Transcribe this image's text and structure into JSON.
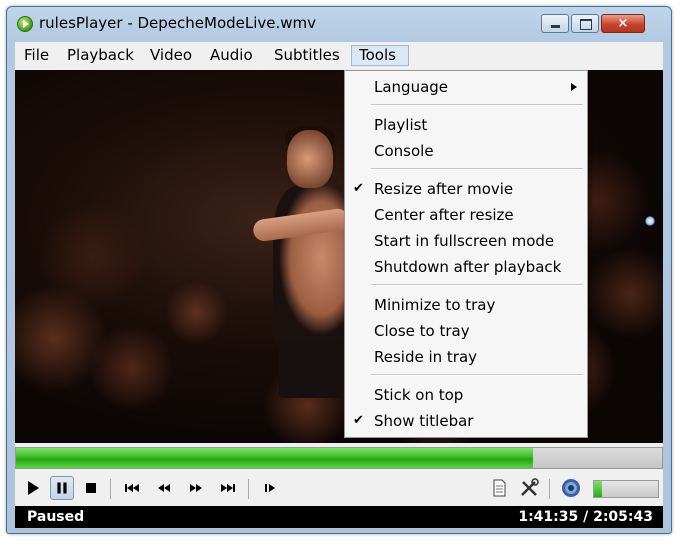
{
  "window": {
    "title": "rulesPlayer - DepecheModeLive.wmv",
    "close_glyph": "×"
  },
  "menubar": {
    "items": [
      {
        "label": "File"
      },
      {
        "label": "Playback"
      },
      {
        "label": "Video"
      },
      {
        "label": "Audio"
      },
      {
        "label": "Subtitles"
      },
      {
        "label": "Tools",
        "active": true
      }
    ]
  },
  "tools_menu": {
    "items": [
      {
        "label": "Language",
        "checked": false,
        "submenu": true
      },
      {
        "label": "Playlist",
        "checked": false
      },
      {
        "label": "Console",
        "checked": false
      },
      {
        "label": "Resize after movie",
        "checked": true
      },
      {
        "label": "Center after resize",
        "checked": false
      },
      {
        "label": "Start in fullscreen mode",
        "checked": false
      },
      {
        "label": "Shutdown after playback",
        "checked": false
      },
      {
        "label": "Minimize to tray",
        "checked": false
      },
      {
        "label": "Close to tray",
        "checked": false
      },
      {
        "label": "Reside in tray",
        "checked": false
      },
      {
        "label": "Stick on top",
        "checked": false
      },
      {
        "label": "Show titlebar",
        "checked": true
      }
    ],
    "check_glyph": "✔"
  },
  "playback": {
    "progress_fraction": 0.8,
    "volume_fraction": 0.12
  },
  "controls": {
    "play_icon": "play-icon",
    "pause_icon": "pause-icon",
    "stop_icon": "stop-icon",
    "prev_icon": "skip-back-icon",
    "rewind_icon": "rewind-icon",
    "forward_icon": "fast-forward-icon",
    "next_icon": "skip-forward-icon",
    "frame_icon": "frame-step-icon",
    "playlist_icon": "document-icon",
    "settings_icon": "tools-icon",
    "mute_icon": "speaker-icon"
  },
  "status": {
    "state": "Paused",
    "time": "1:41:35 / 2:05:43"
  },
  "colors": {
    "progress": "#3cbe28",
    "statusbar": "#000000"
  }
}
